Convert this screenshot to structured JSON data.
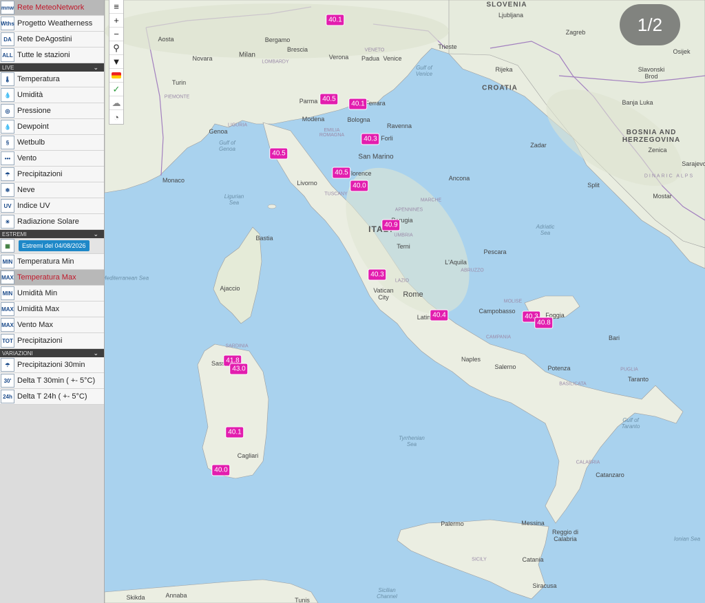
{
  "sidebar": {
    "networks": [
      {
        "label": "Rete MeteoNetwork",
        "icon": "meteonetwork-logo-icon",
        "glyph": "mnw",
        "selected": true
      },
      {
        "label": "Progetto Weatherness",
        "icon": "weatherness-logo-icon",
        "glyph": "Wths",
        "selected": false
      },
      {
        "label": "Rete DeAgostini",
        "icon": "deagostini-logo-icon",
        "glyph": "DA",
        "selected": false
      },
      {
        "label": "Tutte le stazioni",
        "icon": "all-stations-icon",
        "glyph": "ALL",
        "selected": false
      }
    ],
    "live_header": "LIVE",
    "live": [
      {
        "label": "Temperatura",
        "icon": "thermometer-icon",
        "glyph": "🌡"
      },
      {
        "label": "Umidità",
        "icon": "humidity-drop-icon",
        "glyph": "💧"
      },
      {
        "label": "Pressione",
        "icon": "pressure-gauge-icon",
        "glyph": "◎"
      },
      {
        "label": "Dewpoint",
        "icon": "dewpoint-drop-icon",
        "glyph": "💧"
      },
      {
        "label": "Wetbulb",
        "icon": "wetbulb-icon",
        "glyph": "§"
      },
      {
        "label": "Vento",
        "icon": "wind-icon",
        "glyph": "•••"
      },
      {
        "label": "Precipitazioni",
        "icon": "rain-cloud-icon",
        "glyph": "☂"
      },
      {
        "label": "Neve",
        "icon": "snowflake-icon",
        "glyph": "❄"
      },
      {
        "label": "Indice UV",
        "icon": "uv-index-icon",
        "glyph": "UV"
      },
      {
        "label": "Radiazione Solare",
        "icon": "sun-icon",
        "glyph": "☀"
      }
    ],
    "extremes_header": "ESTREMI",
    "extremes_date": "Estremi del 04/08/2026",
    "extremes": [
      {
        "label": "Temperatura Min",
        "icon": "thermometer-min-icon",
        "glyph": "MIN",
        "selected": false
      },
      {
        "label": "Temperatura Max",
        "icon": "thermometer-max-icon",
        "glyph": "MAX",
        "selected": true
      },
      {
        "label": "Umidità Min",
        "icon": "humidity-min-icon",
        "glyph": "MIN",
        "selected": false
      },
      {
        "label": "Umidità Max",
        "icon": "humidity-max-icon",
        "glyph": "MAX",
        "selected": false
      },
      {
        "label": "Vento Max",
        "icon": "wind-max-icon",
        "glyph": "MAX",
        "selected": false
      },
      {
        "label": "Precipitazioni",
        "icon": "rain-total-icon",
        "glyph": "TOT",
        "selected": false
      }
    ],
    "variations_header": "VARIAZIONI",
    "variations": [
      {
        "label": "Precipitazioni 30min",
        "icon": "rain-30min-icon",
        "glyph": "☂"
      },
      {
        "label": "Delta T 30min ( +- 5°C)",
        "icon": "delta-t-30-icon",
        "glyph": "30'"
      },
      {
        "label": "Delta T 24h ( +- 5°C)",
        "icon": "delta-t-24-icon",
        "glyph": "24h"
      }
    ]
  },
  "controls": [
    {
      "name": "layers-menu-button",
      "glyph": "≡"
    },
    {
      "name": "zoom-in-button",
      "glyph": "+"
    },
    {
      "name": "zoom-out-button",
      "glyph": "−"
    },
    {
      "name": "search-button",
      "glyph": "⚲"
    },
    {
      "name": "filter-button",
      "glyph": "▼"
    },
    {
      "name": "flag-layer-button",
      "glyph": "■"
    },
    {
      "name": "check-layer-button",
      "glyph": "✓"
    },
    {
      "name": "clouds-layer-button",
      "glyph": "☁"
    },
    {
      "name": "compass-button",
      "glyph": "◔"
    }
  ],
  "page_indicator": "1/2",
  "markers": [
    {
      "value": "40.1"
    },
    {
      "value": "40.5"
    },
    {
      "value": "40.1"
    },
    {
      "value": "40.3"
    },
    {
      "value": "40.5"
    },
    {
      "value": "40.5"
    },
    {
      "value": "40.0"
    },
    {
      "value": "40.9"
    },
    {
      "value": "40.3"
    },
    {
      "value": "40.4"
    },
    {
      "value": "40.3"
    },
    {
      "value": "40.8"
    },
    {
      "value": "41.8"
    },
    {
      "value": "43.0"
    },
    {
      "value": "40.1"
    },
    {
      "value": "40.0"
    }
  ],
  "places": [
    "SLOVENIA",
    "Ljubljana",
    "Zagreb",
    "CROATIA",
    "BOSNIA AND HERZEGOVINA",
    "ITALY",
    "Milan",
    "Bergamo",
    "Brescia",
    "Verona",
    "Padua",
    "Venice",
    "Trieste",
    "Rijeka",
    "Novara",
    "Turin",
    "Genoa",
    "Parma",
    "Modena",
    "Bologna",
    "Ferrara",
    "Ravenna",
    "Forli",
    "San Marino",
    "Florence",
    "Livorno",
    "Monaco",
    "Ancona",
    "Perugia",
    "Pescara",
    "Terni",
    "L'Aquila",
    "Rome",
    "Vatican City",
    "Latina",
    "Campobasso",
    "Foggia",
    "Bari",
    "Naples",
    "Salerno",
    "Potenza",
    "Taranto",
    "Catanzaro",
    "Reggio di Calabria",
    "Messina",
    "Palermo",
    "Catania",
    "Siracusa",
    "Cagliari",
    "Sassari",
    "Bastia",
    "Ajaccio",
    "Zadar",
    "Split",
    "Mostar",
    "Sarajevo",
    "Zenica",
    "Banja Luka",
    "Osijek",
    "Slavonski Brod",
    "Tunis",
    "Annaba",
    "Skikda",
    "Aosta",
    "Gulf of Venice",
    "Adriatic Sea",
    "Ligurian Sea",
    "Gulf of Genoa",
    "Tyrrhenian Sea",
    "Gulf of Taranto",
    "Ionian Sea",
    "Sicilian Channel",
    "Mediterranean Sea",
    "LOMBARDY",
    "VENETO",
    "PIEMONTE",
    "LIGURIA",
    "EMILIA ROMAGNA",
    "TUSCANY",
    "MARCHE",
    "UMBRIA",
    "LAZIO",
    "ABRUZZO",
    "MOLISE",
    "CAMPANIA",
    "PUGLIA",
    "BASILICATA",
    "CALABRIA",
    "SARDINIA",
    "SICILY",
    "APENNINES",
    "DINARIC ALPS"
  ]
}
